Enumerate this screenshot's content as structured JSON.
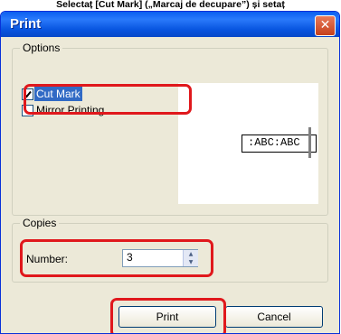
{
  "caption": "Selectaț [Cut Mark] („Marcaj de decupare”) și setaț",
  "window": {
    "title": "Print",
    "close_glyph": "✕"
  },
  "options": {
    "group_label": "Options",
    "items": [
      {
        "label": "Cut Mark",
        "checked": true,
        "selected": true
      },
      {
        "label": "Mirror Printing",
        "checked": false,
        "selected": false
      }
    ],
    "preview_text": ":ABC:ABC"
  },
  "copies": {
    "group_label": "Copies",
    "number_label": "Number:",
    "number_value": "3"
  },
  "buttons": {
    "print": "Print",
    "cancel": "Cancel"
  },
  "colors": {
    "highlight": "#e0181c",
    "titlebar": "#0a5ff0",
    "selection": "#316ac5"
  }
}
